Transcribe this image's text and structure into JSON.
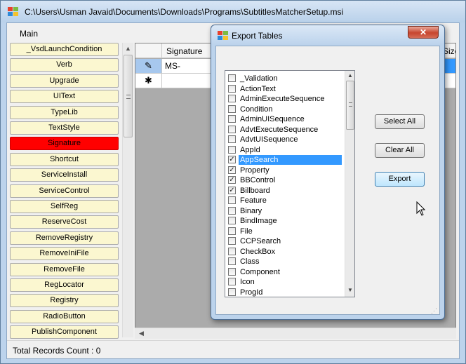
{
  "main_window": {
    "title": "C:\\Users\\Usman Javaid\\Documents\\Downloads\\Programs\\SubtitlesMatcherSetup.msi",
    "menu": [
      "Main"
    ]
  },
  "table_buttons": [
    "_VsdLaunchCondition",
    "Verb",
    "Upgrade",
    "UIText",
    "TypeLib",
    "TextStyle",
    "Signature",
    "Shortcut",
    "ServiceInstall",
    "ServiceControl",
    "SelfReg",
    "ReserveCost",
    "RemoveRegistry",
    "RemoveIniFile",
    "RemoveFile",
    "RegLocator",
    "Registry",
    "RadioButton",
    "PublishComponent"
  ],
  "selected_table": "Signature",
  "grid": {
    "columns": [
      "Signature",
      "xSize"
    ],
    "rows": [
      {
        "marker": "✎",
        "signature": "MS-"
      },
      {
        "marker": "✱",
        "signature": ""
      }
    ]
  },
  "status": {
    "text": "Total Records Count : 0"
  },
  "dialog": {
    "title": "Export Tables",
    "close_label": "✕",
    "tables": [
      {
        "label": "_Validation",
        "checked": false
      },
      {
        "label": "ActionText",
        "checked": false
      },
      {
        "label": "AdminExecuteSequence",
        "checked": false
      },
      {
        "label": "Condition",
        "checked": false
      },
      {
        "label": "AdminUISequence",
        "checked": false
      },
      {
        "label": "AdvtExecuteSequence",
        "checked": false
      },
      {
        "label": "AdvtUISequence",
        "checked": false
      },
      {
        "label": "AppId",
        "checked": false
      },
      {
        "label": "AppSearch",
        "checked": true,
        "selected": true
      },
      {
        "label": "Property",
        "checked": true
      },
      {
        "label": "BBControl",
        "checked": true
      },
      {
        "label": "Billboard",
        "checked": true
      },
      {
        "label": "Feature",
        "checked": false
      },
      {
        "label": "Binary",
        "checked": false
      },
      {
        "label": "BindImage",
        "checked": false
      },
      {
        "label": "File",
        "checked": false
      },
      {
        "label": "CCPSearch",
        "checked": false
      },
      {
        "label": "CheckBox",
        "checked": false
      },
      {
        "label": "Class",
        "checked": false
      },
      {
        "label": "Component",
        "checked": false
      },
      {
        "label": "Icon",
        "checked": false
      },
      {
        "label": "ProgId",
        "checked": false
      }
    ],
    "buttons": {
      "select_all": "Select All",
      "clear_all": "Clear All",
      "export": "Export"
    }
  },
  "colors": {
    "selected_table_button": "#ff0000",
    "table_button": "#fbf7d0",
    "selection_blue": "#3399ff",
    "close_button": "#c7452e"
  }
}
